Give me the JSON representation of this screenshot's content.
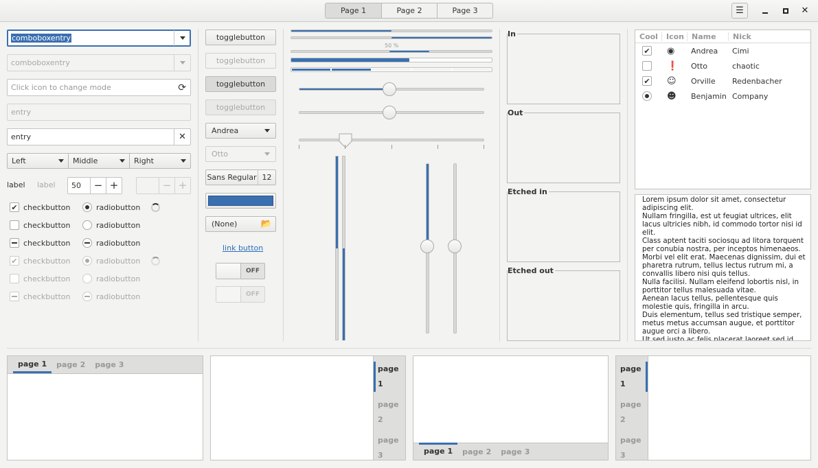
{
  "header": {
    "stack_tabs": [
      "Page 1",
      "Page 2",
      "Page 3"
    ],
    "menu_icon": "hamburger-icon",
    "window_controls": [
      "minimize-icon",
      "maximize-icon",
      "close-icon"
    ]
  },
  "col1": {
    "combo1_value": "comboboxentry",
    "combo2_value": "comboboxentry",
    "entry_mode_placeholder": "Click icon to change mode",
    "entry_disabled": "entry",
    "entry_clear": "entry",
    "seg": [
      "Left",
      "Middle",
      "Right"
    ],
    "label1": "label",
    "label2": "label",
    "spin_value": "50",
    "checks": [
      "checkbutton",
      "checkbutton",
      "checkbutton",
      "checkbutton",
      "checkbutton",
      "checkbutton"
    ],
    "radios": [
      "radiobutton",
      "radiobutton",
      "radiobutton",
      "radiobutton",
      "radiobutton",
      "radiobutton"
    ]
  },
  "col2": {
    "toggles": [
      "togglebutton",
      "togglebutton",
      "togglebutton",
      "togglebutton"
    ],
    "combo_andrea": "Andrea",
    "combo_otto": "Otto",
    "font_name": "Sans Regular",
    "font_size": "12",
    "file_none": "(None)",
    "link": "link button",
    "switch_off1": "OFF",
    "switch_off2": "OFF"
  },
  "col3": {
    "progress_label": "50 %"
  },
  "frames": [
    "In",
    "Out",
    "Etched in",
    "Etched out"
  ],
  "tree": {
    "headers": [
      "Cool",
      "Icon",
      "Name",
      "Nick"
    ],
    "rows": [
      {
        "name": "Andrea",
        "nick": "Cimi",
        "icon": "check-circle-icon"
      },
      {
        "name": "Otto",
        "nick": "chaotic",
        "icon": "warning-icon"
      },
      {
        "name": "Orville",
        "nick": "Redenbacher",
        "icon": "face-icon"
      },
      {
        "name": "Benjamin",
        "nick": "Company",
        "icon": "person-icon"
      }
    ]
  },
  "textview": {
    "lines": [
      "Lorem ipsum dolor sit amet, consectetur",
      "adipiscing elit.",
      "Nullam fringilla, est ut feugiat ultrices, elit",
      "lacus ultricies nibh, id commodo tortor nisi id",
      "elit.",
      "Class aptent taciti sociosqu ad litora torquent",
      "per conubia nostra, per inceptos himenaeos.",
      "Morbi vel elit erat. Maecenas dignissim, dui et",
      "pharetra rutrum, tellus lectus rutrum mi, a",
      "convallis libero nisi quis tellus.",
      "Nulla facilisi. Nullam eleifend lobortis nisl, in",
      "porttitor tellus malesuada vitae.",
      "Aenean lacus tellus, pellentesque quis",
      "molestie quis, fringilla in arcu.",
      "Duis elementum, tellus sed tristique semper,",
      "metus metus accumsan augue, et porttitor",
      "augue orci a libero.",
      "Ut sed justo ac felis placerat laoreet sed id"
    ]
  },
  "notebooks": {
    "tabs": [
      "page 1",
      "page 2",
      "page 3"
    ]
  },
  "colors": {
    "accent": "#3a6fb0",
    "bg": "#f3f3f2"
  }
}
